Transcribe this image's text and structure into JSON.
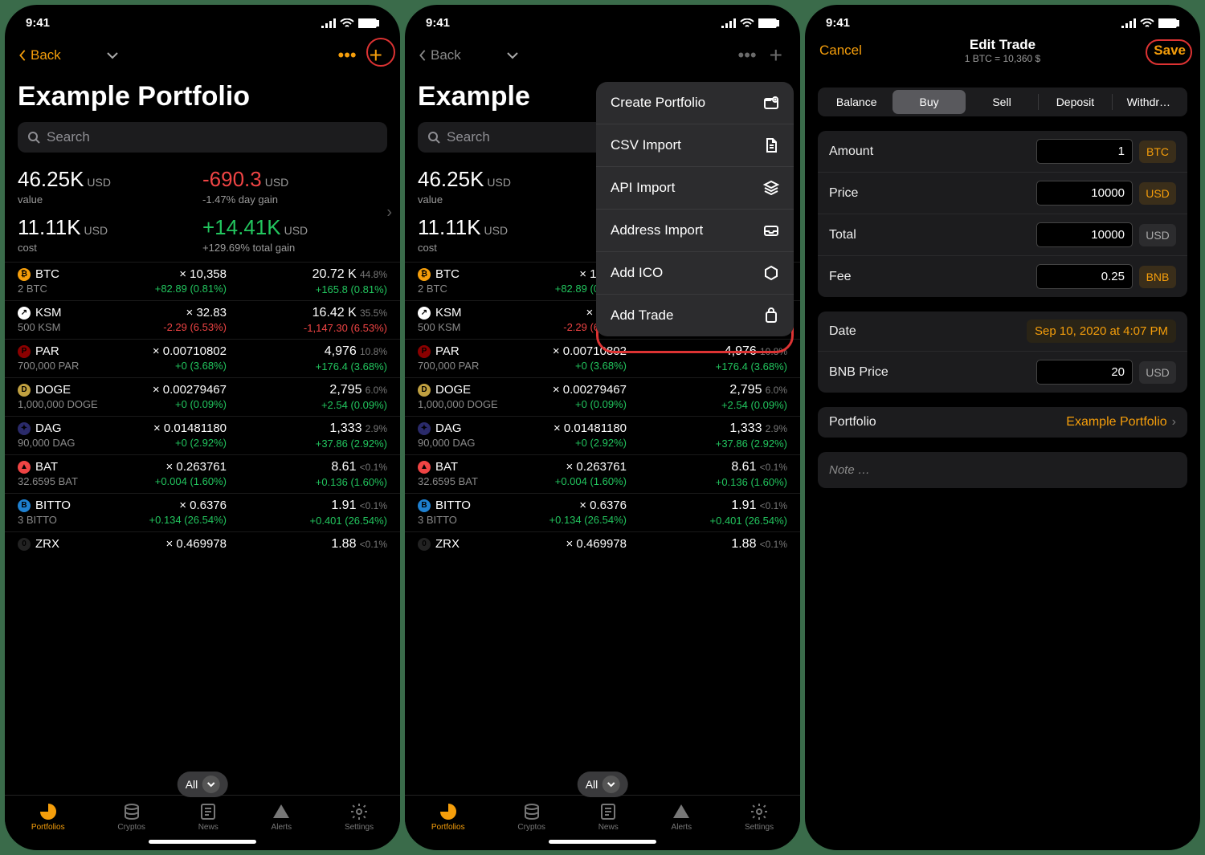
{
  "status": {
    "time": "9:41"
  },
  "screen1": {
    "back": "Back",
    "title": "Example Portfolio",
    "search_placeholder": "Search",
    "summary": {
      "value": "46.25K",
      "value_unit": "USD",
      "value_label": "value",
      "daygain": "-690.3",
      "daygain_unit": "USD",
      "daygain_pct": "-1.47% day gain",
      "cost": "11.11K",
      "cost_unit": "USD",
      "cost_label": "cost",
      "totalgain": "+14.41K",
      "totalgain_unit": "USD",
      "totalgain_pct": "+129.69% total gain"
    },
    "all_label": "All",
    "coins": [
      {
        "sym": "BTC",
        "icon_bg": "#f59e0b",
        "icon_txt": "₿",
        "hold": "2 BTC",
        "price": "× 10,358",
        "price_ch": "+82.89 (0.81%)",
        "price_ch_cls": "green",
        "val": "20.72 K",
        "pct": "44.8%",
        "val_ch": "+165.8 (0.81%)",
        "val_ch_cls": "green"
      },
      {
        "sym": "KSM",
        "icon_bg": "#fff",
        "icon_txt": "↗",
        "hold": "500 KSM",
        "price": "× 32.83",
        "price_ch": "-2.29 (6.53%)",
        "price_ch_cls": "red",
        "val": "16.42 K",
        "pct": "35.5%",
        "val_ch": "-1,147.30 (6.53%)",
        "val_ch_cls": "red"
      },
      {
        "sym": "PAR",
        "icon_bg": "#8b0000",
        "icon_txt": "P",
        "hold": "700,000 PAR",
        "price": "× 0.00710802",
        "price_ch": "+0 (3.68%)",
        "price_ch_cls": "green",
        "val": "4,976",
        "pct": "10.8%",
        "val_ch": "+176.4 (3.68%)",
        "val_ch_cls": "green"
      },
      {
        "sym": "DOGE",
        "icon_bg": "#c0a040",
        "icon_txt": "D",
        "hold": "1,000,000 DOGE",
        "price": "× 0.00279467",
        "price_ch": "+0 (0.09%)",
        "price_ch_cls": "green",
        "val": "2,795",
        "pct": "6.0%",
        "val_ch": "+2.54 (0.09%)",
        "val_ch_cls": "green"
      },
      {
        "sym": "DAG",
        "icon_bg": "#2a2a6a",
        "icon_txt": "✦",
        "hold": "90,000 DAG",
        "price": "× 0.01481180",
        "price_ch": "+0 (2.92%)",
        "price_ch_cls": "green",
        "val": "1,333",
        "pct": "2.9%",
        "val_ch": "+37.86 (2.92%)",
        "val_ch_cls": "green"
      },
      {
        "sym": "BAT",
        "icon_bg": "#ef4444",
        "icon_txt": "▲",
        "hold": "32.6595 BAT",
        "price": "× 0.263761",
        "price_ch": "+0.004 (1.60%)",
        "price_ch_cls": "green",
        "val": "8.61",
        "pct": "<0.1%",
        "val_ch": "+0.136 (1.60%)",
        "val_ch_cls": "green"
      },
      {
        "sym": "BITTO",
        "icon_bg": "#1e80d0",
        "icon_txt": "B",
        "hold": "3 BITTO",
        "price": "× 0.6376",
        "price_ch": "+0.134 (26.54%)",
        "price_ch_cls": "green",
        "val": "1.91",
        "pct": "<0.1%",
        "val_ch": "+0.401 (26.54%)",
        "val_ch_cls": "green"
      },
      {
        "sym": "ZRX",
        "icon_bg": "#222",
        "icon_txt": "0",
        "hold": "",
        "price": "× 0.469978",
        "price_ch": "",
        "price_ch_cls": "",
        "val": "1.88",
        "pct": "<0.1%",
        "val_ch": "",
        "val_ch_cls": ""
      }
    ]
  },
  "dropdown": {
    "items": [
      {
        "label": "Create Portfolio",
        "icon": "folder-plus"
      },
      {
        "label": "CSV Import",
        "icon": "file"
      },
      {
        "label": "API Import",
        "icon": "layers"
      },
      {
        "label": "Address Import",
        "icon": "inbox"
      },
      {
        "label": "Add ICO",
        "icon": "hexagon"
      },
      {
        "label": "Add Trade",
        "icon": "bag"
      }
    ]
  },
  "tabs": {
    "items": [
      "Portfolios",
      "Cryptos",
      "News",
      "Alerts",
      "Settings"
    ],
    "active": 0
  },
  "screen3": {
    "cancel": "Cancel",
    "save": "Save",
    "title": "Edit Trade",
    "subtitle": "1 BTC = 10,360 $",
    "segments": [
      "Balance",
      "Buy",
      "Sell",
      "Deposit",
      "Withdr…"
    ],
    "seg_active": 1,
    "fields": {
      "amount_label": "Amount",
      "amount_val": "1",
      "amount_unit": "BTC",
      "price_label": "Price",
      "price_val": "10000",
      "price_unit": "USD",
      "total_label": "Total",
      "total_val": "10000",
      "total_unit": "USD",
      "fee_label": "Fee",
      "fee_val": "0.25",
      "fee_unit": "BNB"
    },
    "date_label": "Date",
    "date_val": "Sep 10, 2020 at 4:07 PM",
    "bnb_label": "BNB Price",
    "bnb_val": "20",
    "bnb_unit": "USD",
    "portfolio_label": "Portfolio",
    "portfolio_val": "Example Portfolio",
    "note_placeholder": "Note …"
  }
}
